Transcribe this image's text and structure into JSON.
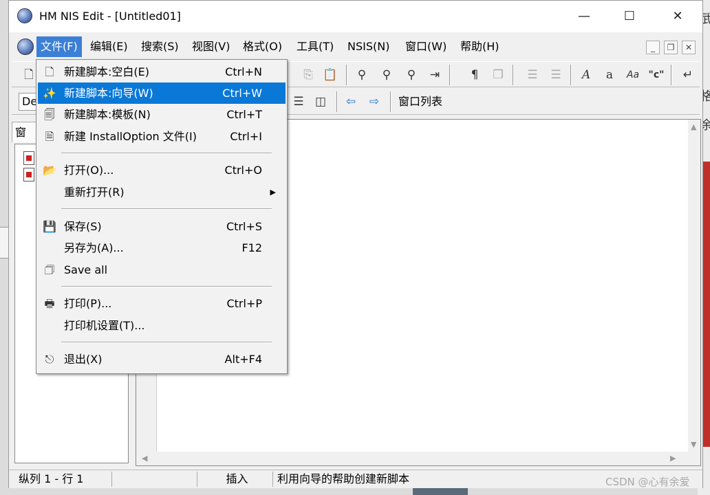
{
  "window": {
    "title": "HM NIS Edit - [Untitled01]",
    "minimize": "—",
    "maximize": "☐",
    "close": "✕"
  },
  "menubar": {
    "items": [
      {
        "label": "文件(F)"
      },
      {
        "label": "编辑(E)"
      },
      {
        "label": "搜索(S)"
      },
      {
        "label": "视图(V)"
      },
      {
        "label": "格式(O)"
      },
      {
        "label": "工具(T)"
      },
      {
        "label": "NSIS(N)"
      },
      {
        "label": "窗口(W)"
      },
      {
        "label": "帮助(H)"
      }
    ],
    "mdi_min": "_",
    "mdi_restore": "❐",
    "mdi_close": "✕"
  },
  "toolbar2": {
    "combo_value": "De",
    "window_list": "窗口列表"
  },
  "side_panel": {
    "tab_label": "窗口"
  },
  "file_menu": {
    "items": [
      {
        "label": "新建脚本:空白(E)",
        "shortcut": "Ctrl+N",
        "icon": "new-file-icon"
      },
      {
        "label": "新建脚本:向导(W)",
        "shortcut": "Ctrl+W",
        "icon": "wizard-icon"
      },
      {
        "label": "新建脚本:模板(N)",
        "shortcut": "Ctrl+T",
        "icon": "template-icon"
      },
      {
        "label": "新建 InstallOption 文件(I)",
        "shortcut": "Ctrl+I",
        "icon": "installoption-icon"
      },
      {
        "label": "打开(O)...",
        "shortcut": "Ctrl+O",
        "icon": "open-folder-icon"
      },
      {
        "label": "重新打开(R)",
        "shortcut": "",
        "icon": ""
      },
      {
        "label": "保存(S)",
        "shortcut": "Ctrl+S",
        "icon": "save-icon"
      },
      {
        "label": "另存为(A)...",
        "shortcut": "F12",
        "icon": ""
      },
      {
        "label": "Save all",
        "shortcut": "",
        "icon": "save-all-icon"
      },
      {
        "label": "打印(P)...",
        "shortcut": "Ctrl+P",
        "icon": "printer-icon"
      },
      {
        "label": "打印机设置(T)...",
        "shortcut": "",
        "icon": ""
      },
      {
        "label": "退出(X)",
        "shortcut": "Alt+F4",
        "icon": "exit-icon"
      }
    ]
  },
  "statusbar": {
    "position": "纵列 1 - 行 1",
    "mode": "插入",
    "hint": "利用向导的帮助创建新脚本"
  },
  "watermark": "CSDN @心有余爱",
  "background": {
    "right_text_1": "武",
    "right_text_2": "格",
    "right_text_3": "余"
  }
}
